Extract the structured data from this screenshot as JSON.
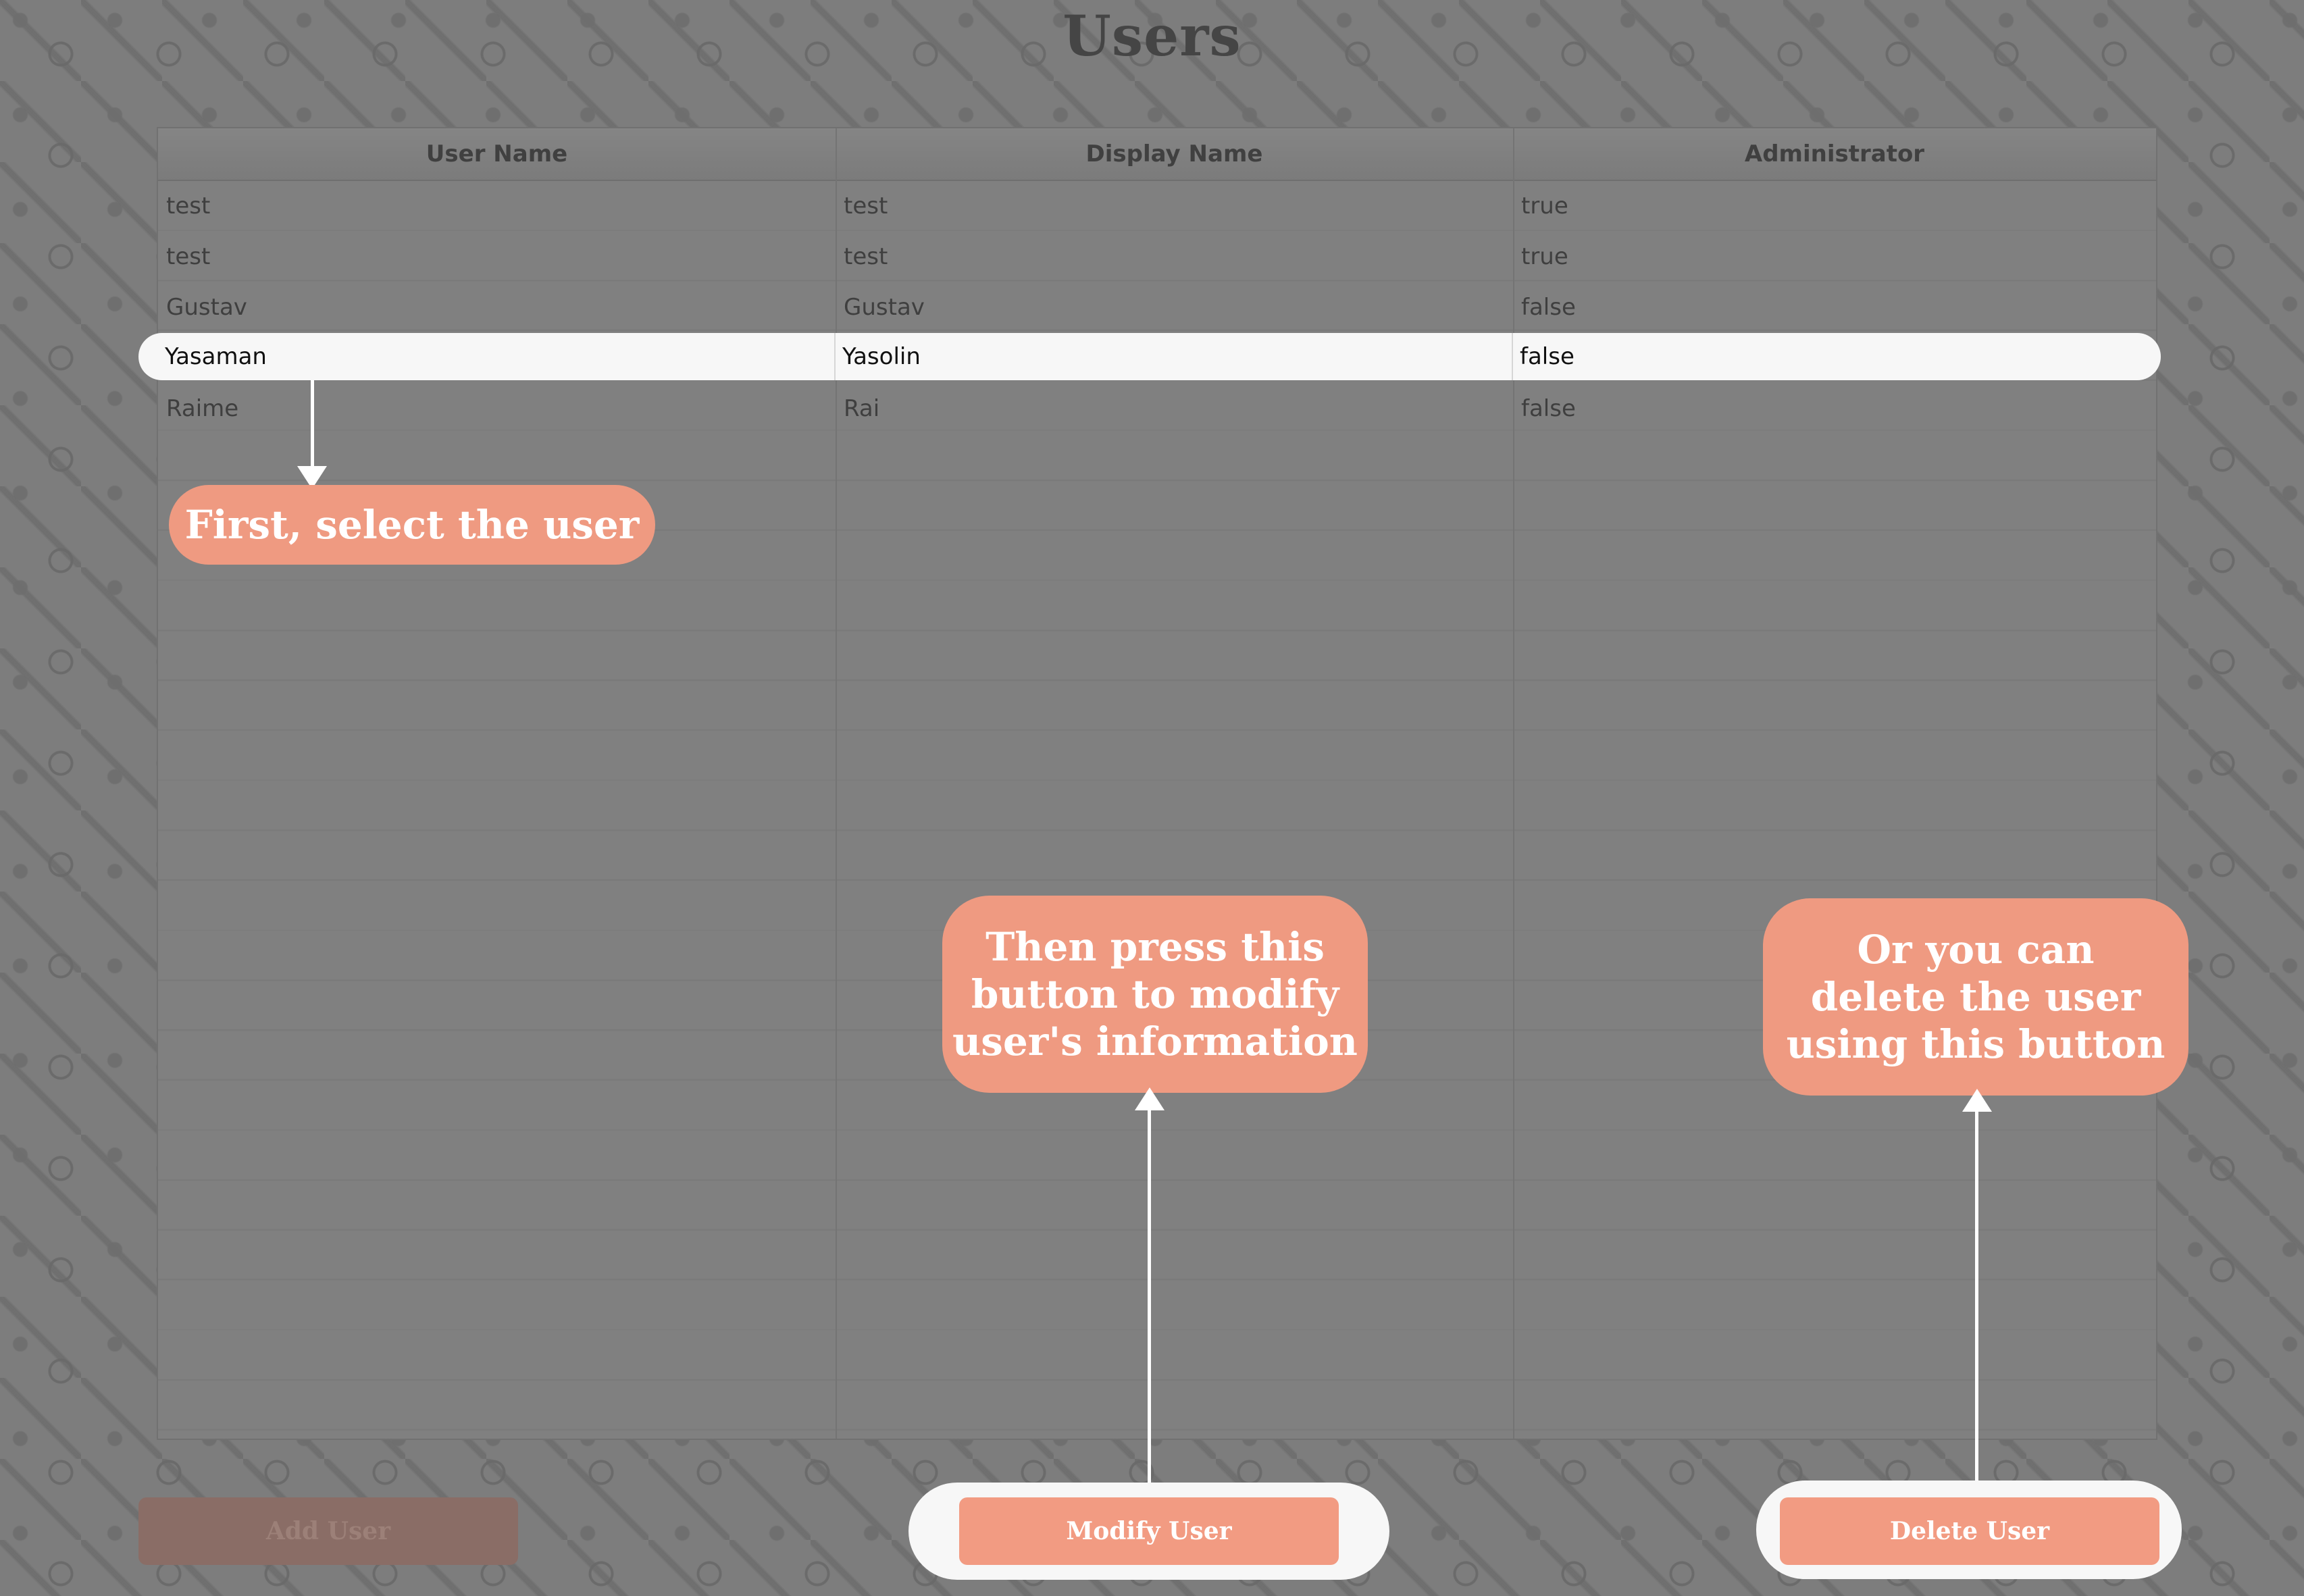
{
  "title": "Users",
  "table": {
    "columns": [
      "User Name",
      "Display Name",
      "Administrator"
    ],
    "rows": [
      {
        "user_name": "test",
        "display_name": "test",
        "administrator": "true"
      },
      {
        "user_name": "test",
        "display_name": "test",
        "administrator": "true"
      },
      {
        "user_name": "Gustav",
        "display_name": "Gustav",
        "administrator": "false"
      },
      {
        "user_name": "Yasaman",
        "display_name": "Yasolin",
        "administrator": "false"
      },
      {
        "user_name": "Raime",
        "display_name": "Rai",
        "administrator": "false"
      }
    ],
    "selected_row_index": 3
  },
  "callouts": {
    "select": "First, select the user",
    "modify": [
      "Then press this",
      "button to modify",
      "user's information"
    ],
    "delete": [
      "Or you can",
      "delete the user",
      "using this button"
    ]
  },
  "buttons": {
    "add": "Add User",
    "modify": "Modify User",
    "delete": "Delete User"
  },
  "colors": {
    "accent": "#f29b82",
    "callout": "#ef9a81",
    "overlay": "#808080"
  }
}
